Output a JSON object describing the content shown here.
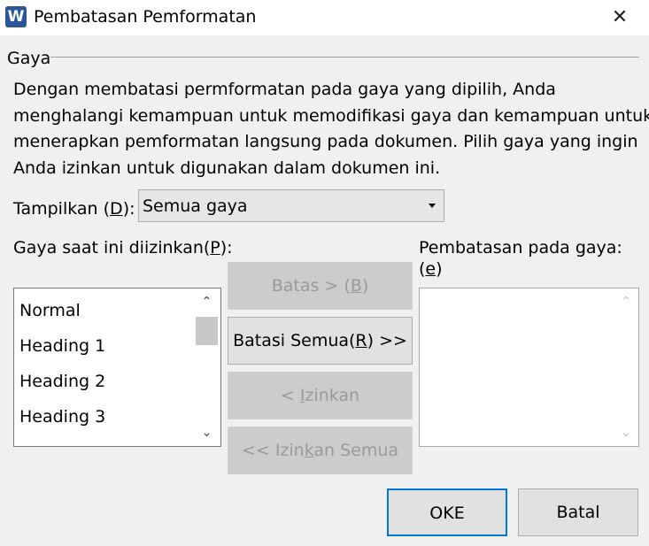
{
  "window": {
    "app_icon_letter": "W",
    "title": "Pembatasan Pemformatan",
    "close_glyph": "✕"
  },
  "group": {
    "label": "Gaya"
  },
  "description": {
    "lines": [
      "Dengan membatasi permformatan pada gaya yang dipilih, Anda",
      "menghalangi kemampuan untuk memodifikasi gaya dan kemampuan untuk",
      "menerapkan pemformatan langsung pada dokumen. Pilih gaya yang ingin",
      "Anda izinkan untuk digunakan dalam dokumen ini."
    ]
  },
  "show": {
    "label_before": "Tampilkan (",
    "label_key": "D",
    "label_after": "):",
    "selected": "Semua gaya"
  },
  "current_allowed": {
    "label_before": "Gaya saat ini diizinkan(",
    "label_key": "P",
    "label_after": "):",
    "items": [
      "Normal",
      "Heading 1",
      "Heading 2",
      "Heading 3"
    ]
  },
  "restrictions": {
    "label_before": "Pembatasan pada gaya: (",
    "label_key": "e",
    "label_after": ")",
    "items": []
  },
  "buttons": {
    "limit": {
      "before": "Batas > (",
      "key": "B",
      "after": ")",
      "enabled": false
    },
    "limit_all": {
      "before": "Batasi Semua(",
      "key": "R",
      "after": ") >>",
      "enabled": true
    },
    "allow": {
      "before": "< ",
      "key": "I",
      "after": "zinkan",
      "enabled": false
    },
    "allow_all": {
      "before": "<< Izin",
      "key": "k",
      "after": "an Semua",
      "enabled": false
    },
    "ok": "OKE",
    "cancel": "Batal"
  },
  "scroll": {
    "up_glyph": "⌃",
    "down_glyph": "⌄"
  },
  "colors": {
    "accent": "#0078d7",
    "app_icon": "#2b579a"
  }
}
